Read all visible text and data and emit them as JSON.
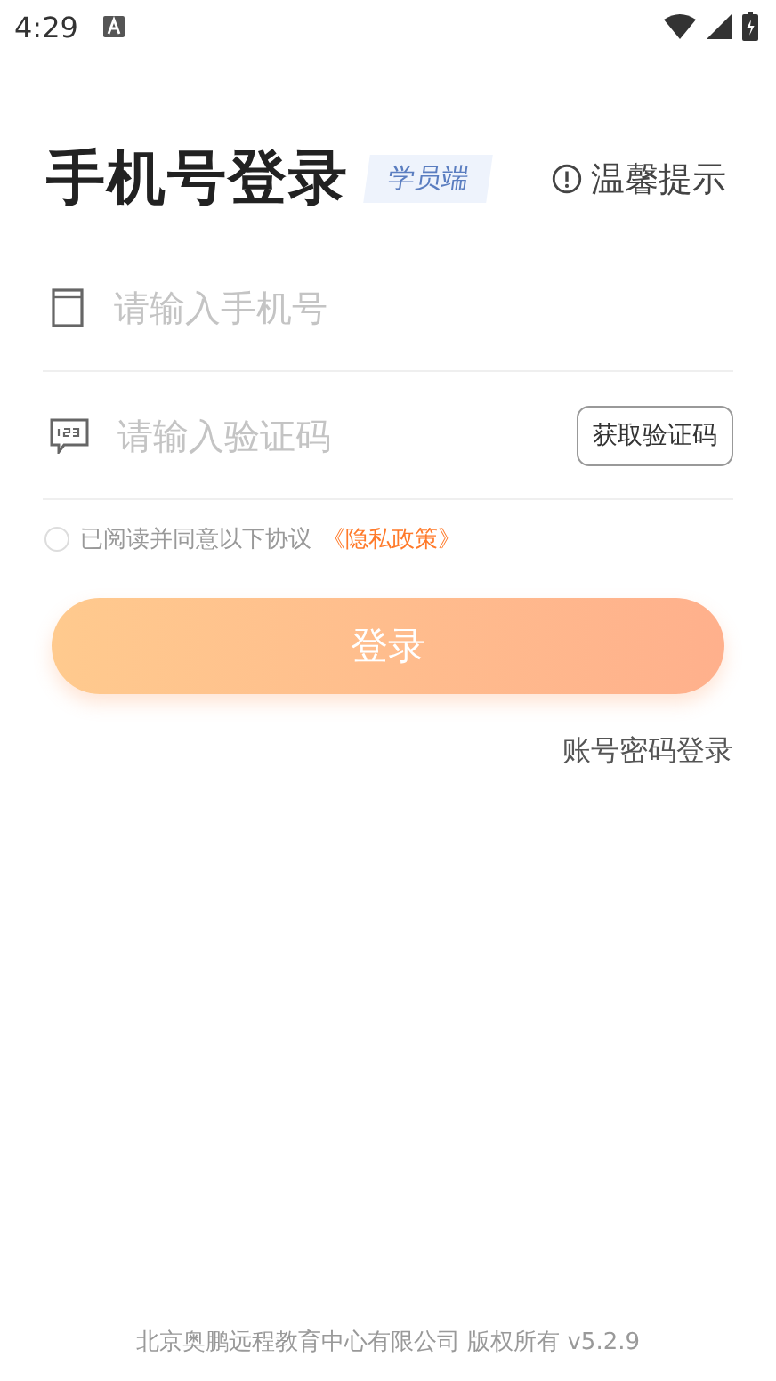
{
  "status_bar": {
    "time": "4:29"
  },
  "header": {
    "title": "手机号登录",
    "role_tag": "学员端",
    "tip": "温馨提示"
  },
  "phone_field": {
    "placeholder": "请输入手机号"
  },
  "code_field": {
    "placeholder": "请输入验证码",
    "send_button": "获取验证码"
  },
  "agreement": {
    "checked": false,
    "text": "已阅读并同意以下协议",
    "link": "《隐私政策》"
  },
  "login_button": {
    "label": "登录",
    "disabled": true
  },
  "alt_login": "账号密码登录",
  "footer": "北京奥鹏远程教育中心有限公司 版权所有 v5.2.9"
}
